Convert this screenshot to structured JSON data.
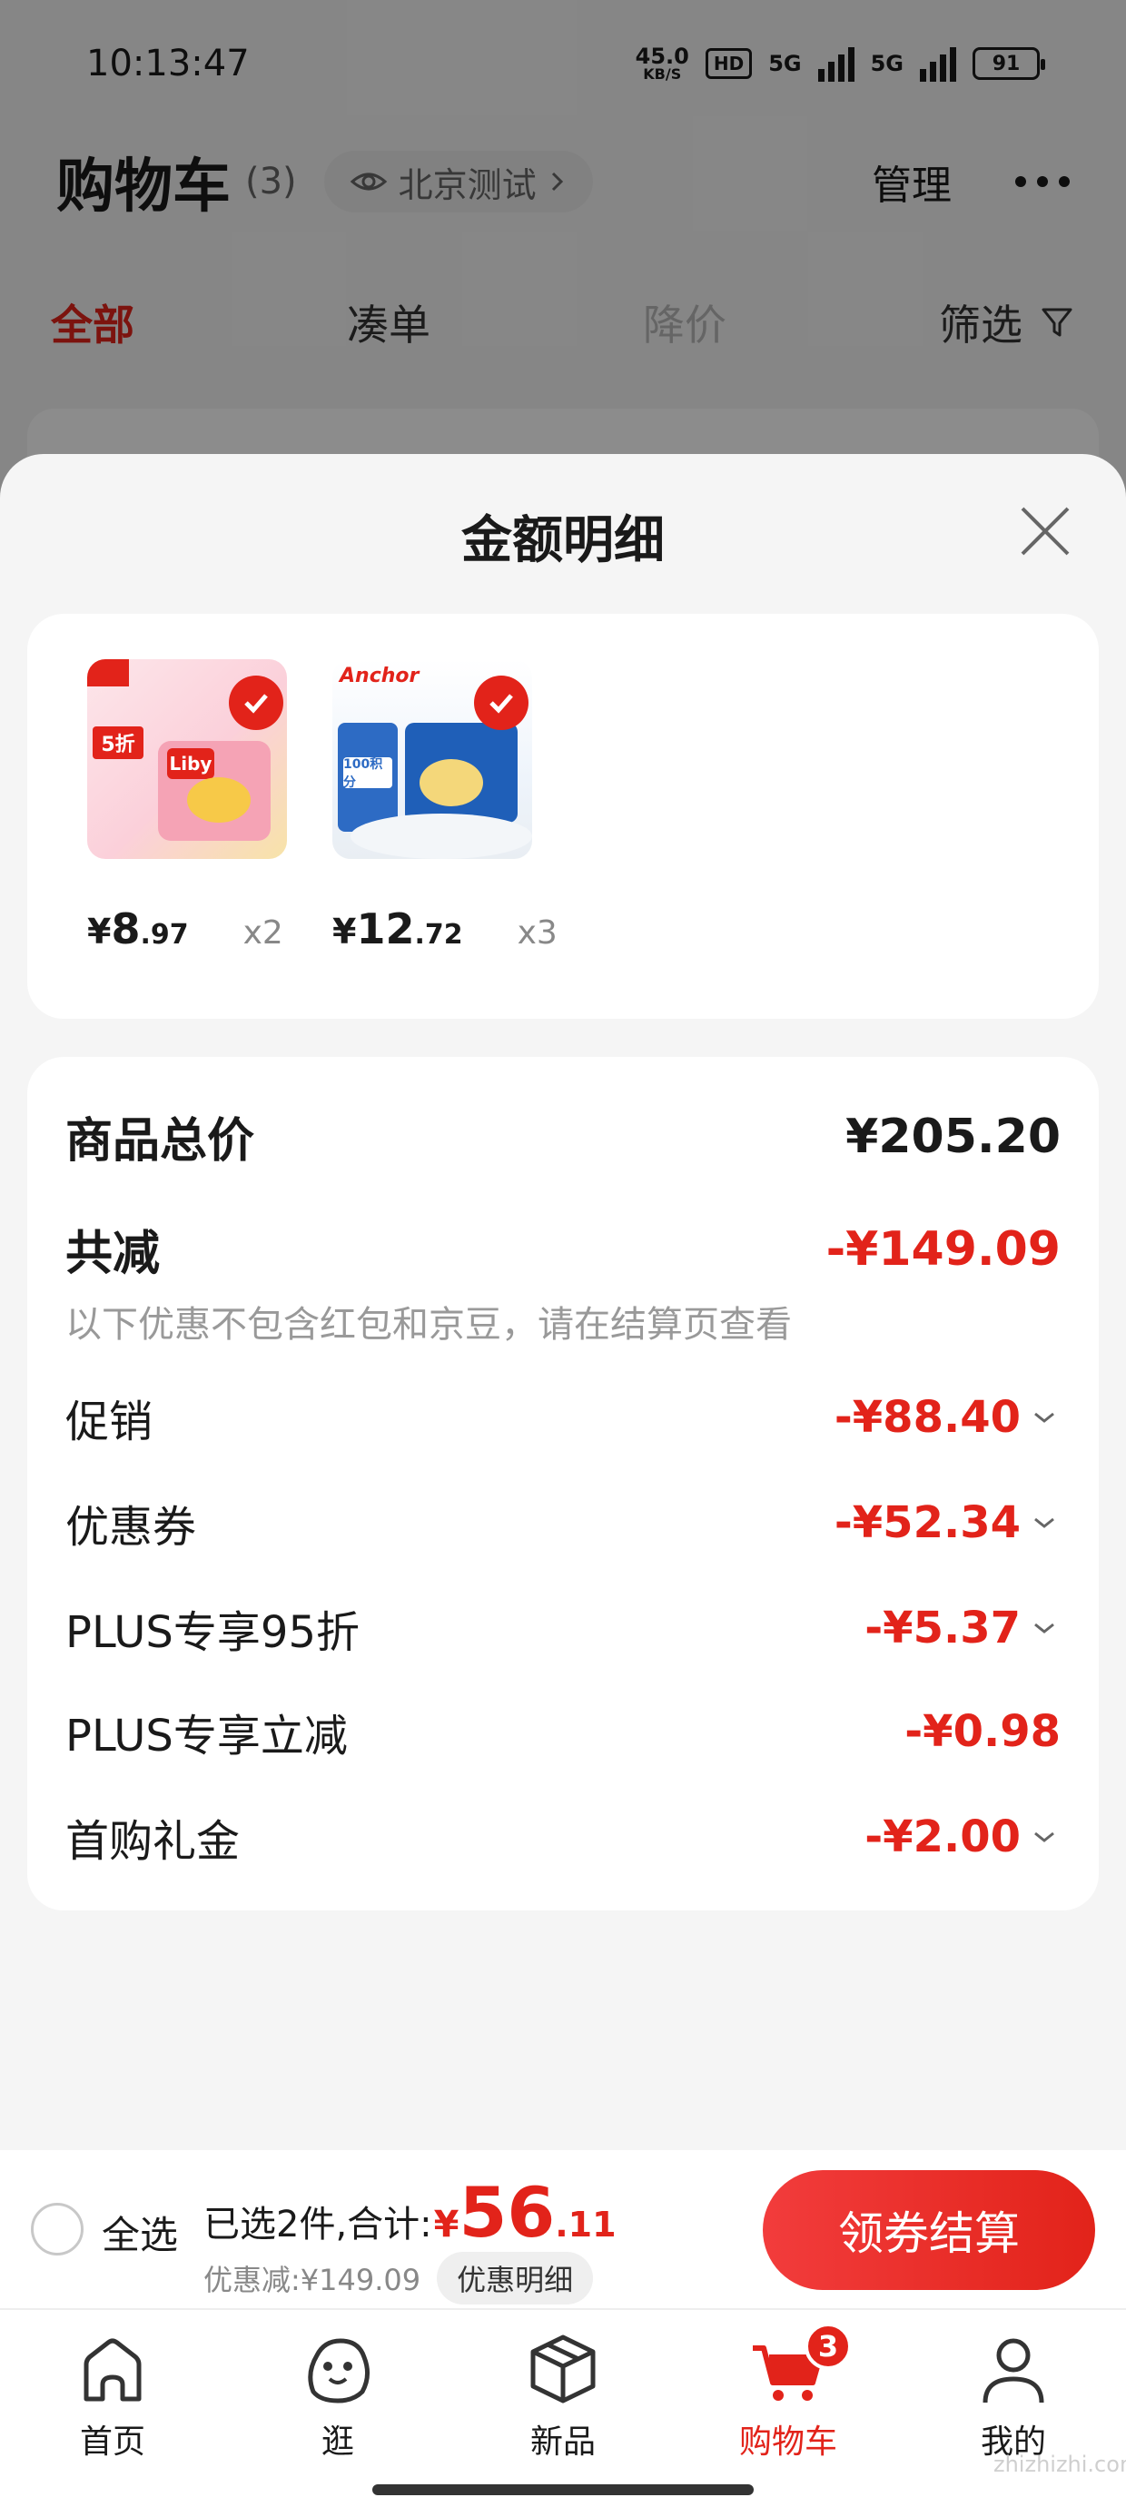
{
  "status_bar": {
    "time": "10:13:47",
    "net_speed": "45.0",
    "net_unit": "KB/S",
    "hd_label": "HD",
    "sig1_label": "5G",
    "sig2_label": "5G",
    "battery": "91"
  },
  "header": {
    "title": "购物车",
    "count": "(3)",
    "location": "北京测试",
    "manage": "管理"
  },
  "tabs": {
    "all": "全部",
    "bundle": "凑单",
    "price_drop": "降价",
    "filter": "筛选"
  },
  "sheet": {
    "title": "金额明细",
    "products": [
      {
        "yen": "¥",
        "int": "8",
        "dec": ".97",
        "qty": "x2",
        "brand": "Liby",
        "tag": "5折"
      },
      {
        "yen": "¥",
        "int": "12",
        "dec": ".72",
        "qty": "x3",
        "brand": "Anchor",
        "tag": "100积分"
      }
    ],
    "total_label": "商品总价",
    "total_value": "¥205.20",
    "reduce_label": "共减",
    "reduce_value": "-¥149.09",
    "note": "以下优惠不包含红包和京豆，请在结算页查看",
    "items": [
      {
        "label": "促销",
        "value": "-¥88.40"
      },
      {
        "label": "优惠券",
        "value": "-¥52.34"
      },
      {
        "label": "PLUS专享95折",
        "value": "-¥5.37"
      },
      {
        "label": "PLUS专享立减",
        "value": "-¥0.98"
      },
      {
        "label": "首购礼金",
        "value": "-¥2.00"
      }
    ]
  },
  "checkout": {
    "select_all": "全选",
    "selected_text": "已选2件,合计:",
    "total_yen": "¥",
    "total_int": "56",
    "total_dec": ".11",
    "saved_text": "优惠减:¥149.09",
    "detail_button": "优惠明细",
    "checkout_button": "领券结算"
  },
  "tabbar": {
    "home": "首页",
    "browse": "逛",
    "new": "新品",
    "cart": "购物车",
    "cart_badge": "3",
    "me": "我的"
  },
  "watermark": "zhizhizhi.com",
  "colors": {
    "accent": "#e2231a",
    "muted": "#999999"
  }
}
